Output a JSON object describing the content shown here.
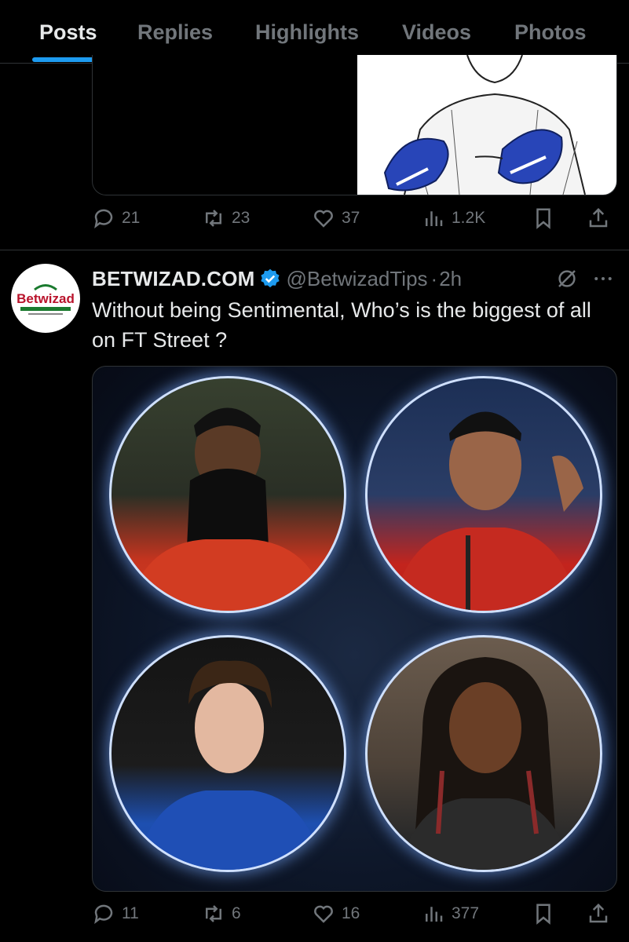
{
  "tabs": [
    {
      "label": "Posts",
      "active": true
    },
    {
      "label": "Replies"
    },
    {
      "label": "Highlights"
    },
    {
      "label": "Videos"
    },
    {
      "label": "Photos"
    }
  ],
  "prev_post": {
    "actions": {
      "replies": "21",
      "reposts": "23",
      "likes": "37",
      "views": "1.2K"
    }
  },
  "post": {
    "author_name": "BETWIZAD.COM",
    "verified": true,
    "handle": "@BetwizadTips",
    "separator": "·",
    "time": "2h",
    "avatar_logo": "Betwizad",
    "text": "Without being Sentimental, Who’s is the biggest of all on FT Street ?",
    "actions": {
      "replies": "11",
      "reposts": "6",
      "likes": "16",
      "views": "377"
    }
  },
  "icons": {
    "reply": "reply-icon",
    "repost": "repost-icon",
    "like": "heart-icon",
    "views": "views-icon",
    "bookmark": "bookmark-icon",
    "share": "share-icon",
    "grok": "grok-icon",
    "more": "more-icon",
    "verified": "verified-badge-icon"
  },
  "colors": {
    "accent": "#1d9bf0",
    "muted": "#71767b",
    "text": "#e7e9ea",
    "bg": "#000000"
  }
}
